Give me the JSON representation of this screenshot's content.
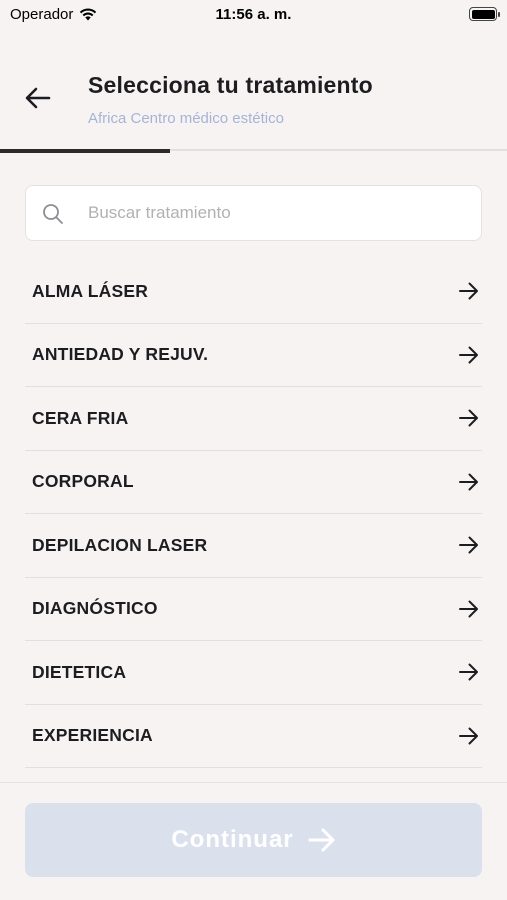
{
  "status_bar": {
    "carrier": "Operador",
    "time": "11:56 a. m."
  },
  "header": {
    "title": "Selecciona tu tratamiento",
    "subtitle": "Africa Centro médico estético",
    "back_icon": "arrow-left-icon"
  },
  "progress": {
    "fraction": 0.335
  },
  "search": {
    "placeholder": "Buscar tratamiento",
    "value": "",
    "icon": "search-icon"
  },
  "treatments": [
    {
      "label": "ALMA LÁSER"
    },
    {
      "label": "ANTIEDAD Y REJUV."
    },
    {
      "label": "CERA FRIA"
    },
    {
      "label": "CORPORAL"
    },
    {
      "label": "DEPILACION LASER"
    },
    {
      "label": "DIAGNÓSTICO"
    },
    {
      "label": "DIETETICA"
    },
    {
      "label": "EXPERIENCIA"
    }
  ],
  "footer": {
    "continue_label": "Continuar",
    "continue_icon": "arrow-right-icon"
  },
  "colors": {
    "background": "#f7f3f2",
    "subtitle": "#a5b4d6",
    "button_disabled": "#dbe1ec",
    "progress": "#2c2a2a"
  }
}
